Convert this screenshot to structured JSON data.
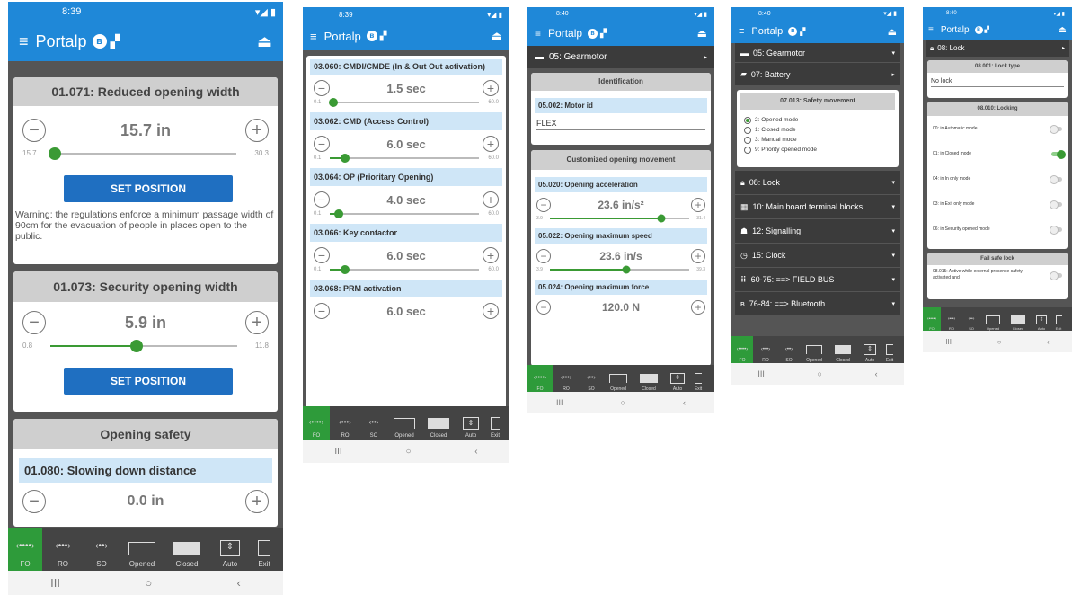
{
  "status_bar": {
    "time1": "8:39",
    "time2": "8:39",
    "time3": "8:40",
    "time4": "8:40",
    "time5": "8:40"
  },
  "app": {
    "title": "Portalp"
  },
  "bottom_tabs": [
    {
      "label": "FO",
      "glyph": "‹••••›"
    },
    {
      "label": "RO",
      "glyph": "‹•••›"
    },
    {
      "label": "SO",
      "glyph": "‹••›"
    },
    {
      "label": "Opened",
      "glyph": "⎴"
    },
    {
      "label": "Closed",
      "glyph": "▭"
    },
    {
      "label": "Auto",
      "glyph": "⇕"
    },
    {
      "label": "Exit",
      "glyph": "⌐"
    }
  ],
  "nav": {
    "recent": "III",
    "home": "○",
    "back": "‹"
  },
  "screen1": {
    "card1_title": "01.071: Reduced opening width",
    "card1_value": "15.7 in",
    "card1_min": "15.7",
    "card1_max": "30.3",
    "card1_level": 0.0,
    "set_position": "SET POSITION",
    "warning": "Warning: the regulations enforce a minimum passage width of 90cm for the evacuation of people in places open to the public.",
    "card2_title": "01.073: Security opening width",
    "card2_value": "5.9 in",
    "card2_min": "0.8",
    "card2_max": "11.8",
    "card2_level": 0.46,
    "safety_title": "Opening safety",
    "param_080": "01.080: Slowing down distance",
    "param_080_value": "0.0 in"
  },
  "screen2": {
    "p060": "03.060: CMDI/CMDE (In & Out Out activation)",
    "p060_value": "1.5 sec",
    "p062": "03.062: CMD (Access Control)",
    "p062_value": "6.0 sec",
    "p064": "03.064: OP (Prioritary Opening)",
    "p064_value": "4.0 sec",
    "p066": "03.066: Key contactor",
    "p066_value": "6.0 sec",
    "p068": "03.068: PRM activation",
    "p068_value": "6.0 sec",
    "min": "0.1",
    "max": "60.0"
  },
  "screen3": {
    "menu_gearmotor": "05: Gearmotor",
    "ident_title": "Identification",
    "motor_id_label": "05.002: Motor id",
    "motor_id_value": "FLEX",
    "custom_title": "Customized opening movement",
    "p020": "05.020: Opening acceleration",
    "p020_value": "23.6 in/s²",
    "p020_min": "3.9",
    "p020_max": "31.4",
    "p022": "05.022: Opening maximum speed",
    "p022_value": "23.6 in/s",
    "p022_min": "3.9",
    "p022_max": "39.3",
    "p024": "05.024: Opening maximum force",
    "p024_value": "120.0 N"
  },
  "screen4": {
    "menu": [
      "05: Gearmotor",
      "07: Battery"
    ],
    "safety_title": "07.013: Safety movement",
    "options": [
      "2: Opened mode",
      "1: Closed mode",
      "3: Manual mode",
      "9: Priority opened mode"
    ],
    "menu2": [
      "08: Lock",
      "10: Main board terminal blocks",
      "12: Signalling",
      "15: Clock",
      "60-75: ==> FIELD BUS",
      "76-84: ==> Bluetooth"
    ]
  },
  "screen5": {
    "menu_lock": "08: Lock",
    "lock_type_title": "08.001: Lock type",
    "lock_type_value": "No lock",
    "locking_title": "08.010: Locking",
    "toggles": [
      "00: in Automatic mode",
      "01: in Closed mode",
      "04: in In only mode",
      "03: in Exit only mode",
      "06: in Security opened mode"
    ],
    "failsafe_title": "Fail safe lock",
    "failsafe_item": "08.015: Active while external presence safety activated and"
  }
}
